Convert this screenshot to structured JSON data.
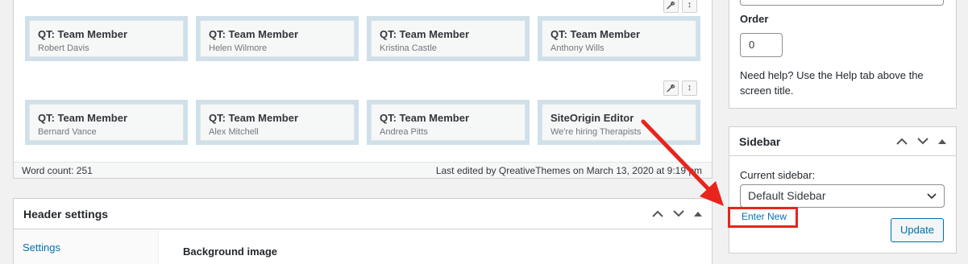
{
  "editor": {
    "rows": [
      {
        "widgets": [
          {
            "title": "QT: Team Member",
            "subtitle": "Robert Davis"
          },
          {
            "title": "QT: Team Member",
            "subtitle": "Helen Wilmore"
          },
          {
            "title": "QT: Team Member",
            "subtitle": "Kristina Castle"
          },
          {
            "title": "QT: Team Member",
            "subtitle": "Anthony Wills"
          }
        ]
      },
      {
        "widgets": [
          {
            "title": "QT: Team Member",
            "subtitle": "Bernard Vance"
          },
          {
            "title": "QT: Team Member",
            "subtitle": "Alex Mitchell"
          },
          {
            "title": "QT: Team Member",
            "subtitle": "Andrea Pitts"
          },
          {
            "title": "SiteOrigin Editor",
            "subtitle": "We're hiring Therapists"
          }
        ]
      }
    ],
    "word_count": "Word count: 251",
    "last_edited": "Last edited by QreativeThemes on March 13, 2020 at 9:19 pm"
  },
  "header_settings": {
    "title": "Header settings",
    "nav_item": "Settings",
    "section_label": "Background image"
  },
  "attributes": {
    "order_label": "Order",
    "order_value": "0",
    "help_text": "Need help? Use the Help tab above the screen title."
  },
  "sidebar_box": {
    "title": "Sidebar",
    "current_label": "Current sidebar:",
    "selected": "Default Sidebar",
    "enter_new": "Enter New",
    "update_label": "Update"
  },
  "colors": {
    "accent": "#0073aa",
    "annotation": "#e8241c",
    "cell_bg": "#cfe0ea"
  }
}
